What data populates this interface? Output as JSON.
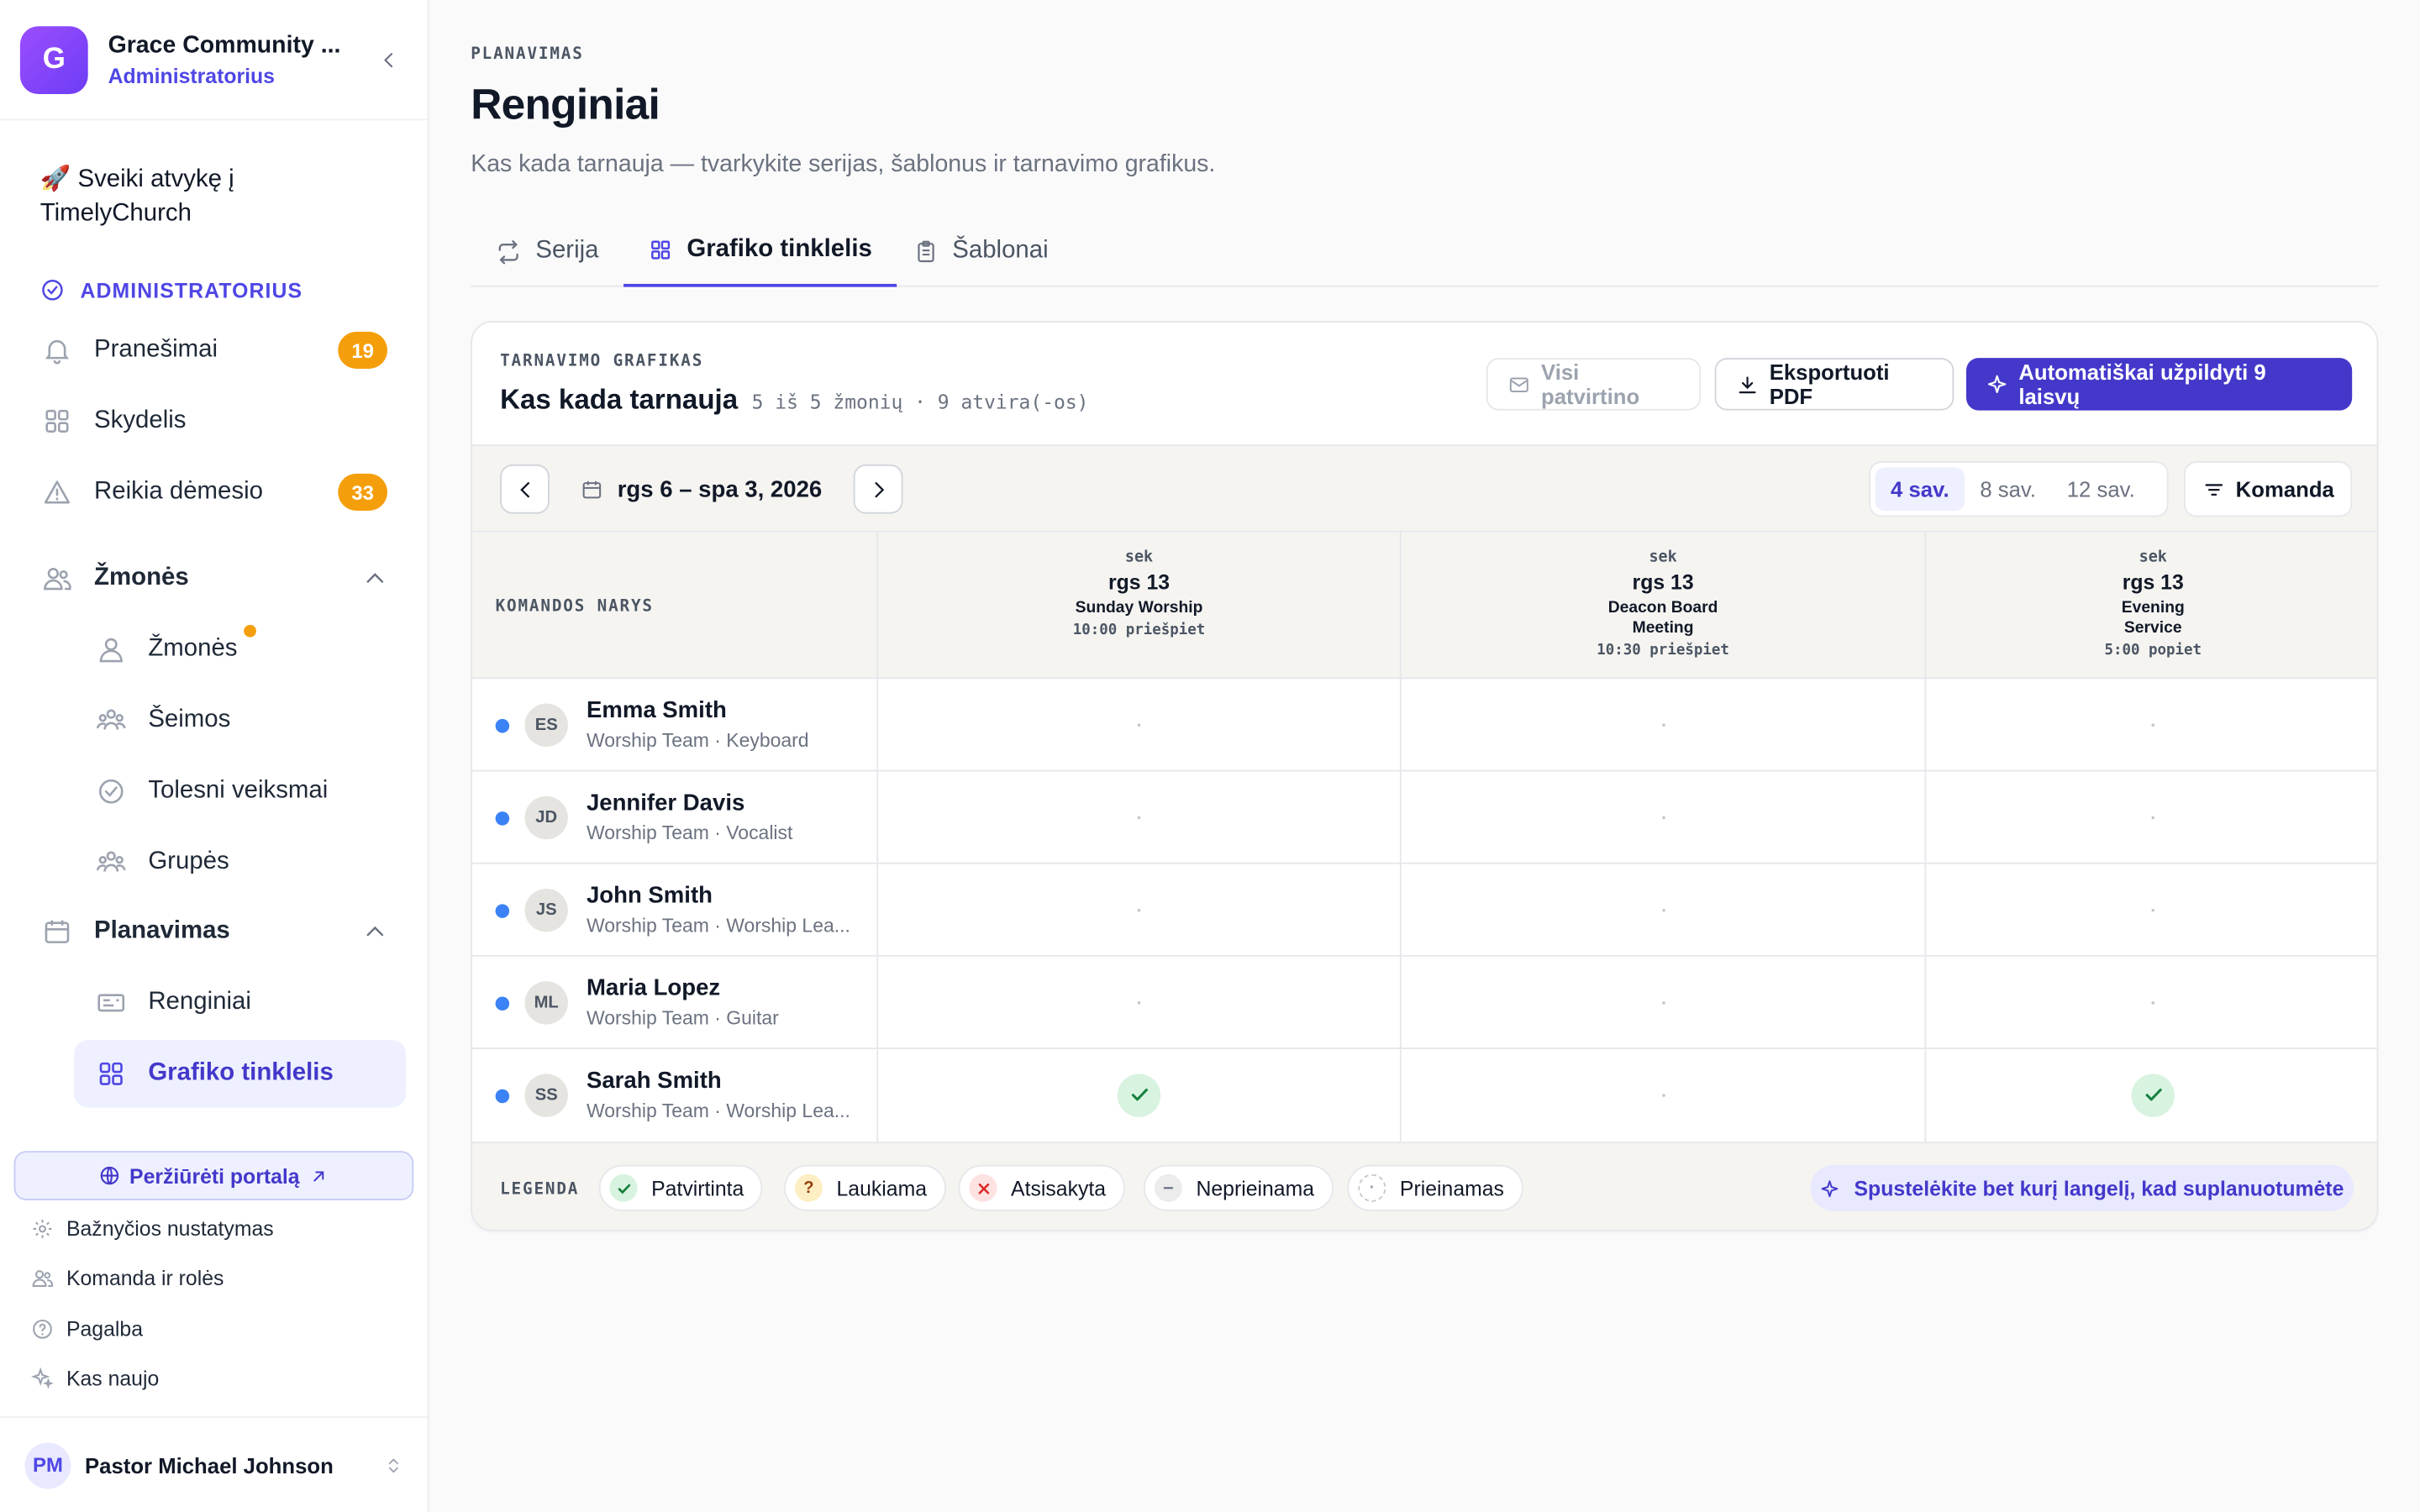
{
  "org": {
    "initial": "G",
    "name": "Grace Community ...",
    "role": "Administratorius"
  },
  "sidebar": {
    "welcome": "🚀 Sveiki atvykę į TimelyChurch",
    "admin_header": "ADMINISTRATORIUS",
    "items": [
      {
        "label": "Pranešimai",
        "badge": "19"
      },
      {
        "label": "Skydelis"
      },
      {
        "label": "Reikia dėmesio",
        "badge": "33"
      }
    ],
    "people_section": "Žmonės",
    "people_items": [
      "Žmonės",
      "Šeimos",
      "Tolesni veiksmai",
      "Grupės"
    ],
    "planning_section": "Planavimas",
    "planning_items": [
      "Renginiai",
      "Grafiko tinklelis"
    ],
    "portal_button": "Peržiūrėti portalą",
    "footer_items": [
      "Bažnyčios nustatymas",
      "Komanda ir rolės",
      "Pagalba",
      "Kas naujo"
    ],
    "user": {
      "initials": "PM",
      "name": "Pastor Michael Johnson"
    }
  },
  "page": {
    "eyebrow": "PLANAVIMAS",
    "title": "Renginiai",
    "subtitle": "Kas kada tarnauja — tvarkykite serijas, šablonus ir tarnavimo grafikus.",
    "tabs": [
      "Serija",
      "Grafiko tinklelis",
      "Šablonai"
    ]
  },
  "card": {
    "eyebrow": "TARNAVIMO GRAFIKAS",
    "title": "Kas kada tarnauja",
    "meta": "5 iš 5 žmonių · 9 atvira(-os)",
    "btn_confirmed": "Visi patvirtino",
    "btn_export": "Eksportuoti PDF",
    "btn_autofill": "Automatiškai užpildyti 9 laisvų",
    "range": "rgs 6 – spa 3, 2026",
    "segments": [
      "4 sav.",
      "8 sav.",
      "12 sav."
    ],
    "team_button": "Komanda",
    "member_header": "KOMANDOS NARYS",
    "columns": [
      {
        "dow": "sek",
        "date": "rgs 13",
        "name": "Sunday Worship",
        "time": "10:00 priešpiet"
      },
      {
        "dow": "sek",
        "date": "rgs 13",
        "name": "Deacon Board Meeting",
        "time": "10:30 priešpiet"
      },
      {
        "dow": "sek",
        "date": "rgs 13",
        "name": "Evening Service",
        "time": "5:00 popiet"
      }
    ],
    "rows": [
      {
        "initials": "ES",
        "name": "Emma Smith",
        "role": "Worship Team · Keyboard",
        "cells": [
          "",
          "",
          ""
        ]
      },
      {
        "initials": "JD",
        "name": "Jennifer Davis",
        "role": "Worship Team · Vocalist",
        "cells": [
          "",
          "",
          ""
        ]
      },
      {
        "initials": "JS",
        "name": "John Smith",
        "role": "Worship Team · Worship Lea...",
        "cells": [
          "",
          "",
          ""
        ]
      },
      {
        "initials": "ML",
        "name": "Maria Lopez",
        "role": "Worship Team · Guitar",
        "cells": [
          "",
          "",
          ""
        ]
      },
      {
        "initials": "SS",
        "name": "Sarah Smith",
        "role": "Worship Team · Worship Lea...",
        "cells": [
          "confirmed",
          "",
          "confirmed"
        ]
      }
    ],
    "legend_title": "LEGENDA",
    "legend": [
      "Patvirtinta",
      "Laukiama",
      "Atsisakyta",
      "Neprieinama",
      "Prieinamas"
    ],
    "hint": "Spustelėkite bet kurį langelį, kad suplanuotumėte"
  },
  "colors": {
    "accent": "#4338ca",
    "badge": "#f59e0b",
    "confirmed_bg": "#d8f3e0",
    "confirmed": "#15803d"
  }
}
